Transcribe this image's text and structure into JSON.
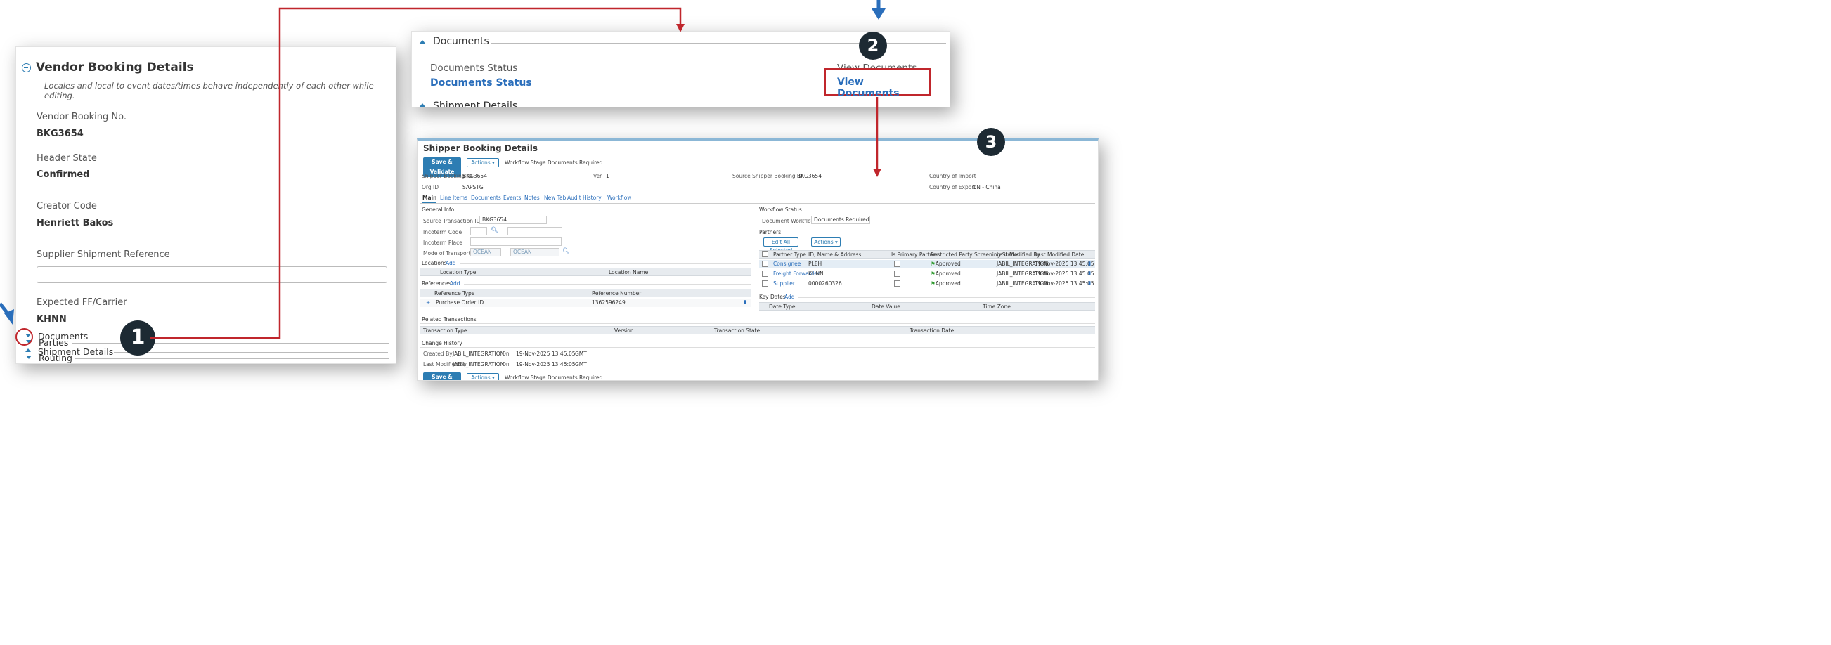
{
  "vendor": {
    "title": "Vendor Booking Details",
    "note": "Locales and local to event dates/times behave independently of each other while editing.",
    "booking_no_label": "Vendor Booking No.",
    "booking_no": "BKG3654",
    "header_state_label": "Header State",
    "header_state": "Confirmed",
    "creator_label": "Creator Code",
    "creator": "Henriett Bakos",
    "supplier_ref_label": "Supplier Shipment Reference",
    "supplier_ref_value": "",
    "carrier_label": "Expected FF/Carrier",
    "carrier": "KHNN",
    "sections": [
      "Parties",
      "Routing",
      "Documents",
      "Shipment Details"
    ]
  },
  "documents": {
    "title": "Documents",
    "status_label": "Documents Status",
    "status_link": "Documents Status",
    "view_label": "View Documents",
    "view_link": "View Documents",
    "next_section": "Shipment Details"
  },
  "steps": [
    "1",
    "2",
    "3"
  ],
  "shipper": {
    "title": "Shipper Booking Details",
    "save_btn": "Save & Validate",
    "actions_btn": "Actions",
    "workflow_stage": "Workflow Stage Documents Required",
    "booking_id_label": "Shipper Booking ID",
    "booking_id": "BKG3654",
    "ver_label": "Ver",
    "ver": "1",
    "source_id_label": "Source Shipper Booking ID",
    "source_id": "BKG3654",
    "org_label": "Org ID",
    "org": "SAPSTG",
    "country_import_label": "Country of Import",
    "country_import": "-",
    "country_export_label": "Country of Export",
    "country_export": "CN - China",
    "tabs": [
      "Main",
      "Line Items",
      "Documents",
      "Events",
      "Notes",
      "New Tab",
      "Audit History",
      "Workflow"
    ],
    "general_info": {
      "title": "General Info",
      "src_txn_label": "Source Transaction ID",
      "src_txn": "BKG3654",
      "incoterm_code_label": "Incoterm Code",
      "incoterm_place_label": "Incoterm Place",
      "mode_label": "Mode of Transport Code",
      "mode1": "OCEAN",
      "mode2": "OCEAN"
    },
    "locations": {
      "title": "Locations",
      "add": "Add",
      "col1": "Location Type",
      "col2": "Location Name"
    },
    "references": {
      "title": "References",
      "add": "Add",
      "col1": "Reference Type",
      "col2": "Reference Number",
      "row_type": "Purchase Order ID",
      "row_num": "1362596249"
    },
    "workflow": {
      "title": "Workflow Status",
      "label": "Document Workflow Stage",
      "value": "Documents Required"
    },
    "partners": {
      "title": "Partners",
      "edit_all": "Edit All Selected",
      "actions": "Actions",
      "headers": [
        "Partner Type",
        "ID, Name & Address",
        "Is Primary Partner",
        "Restricted Party Screening Status",
        "Last Modified By",
        "Last Modified Date"
      ],
      "rows": [
        {
          "type": "Consignee",
          "id": "PLEH",
          "status": "Approved",
          "by": "JABIL_INTEGRATION",
          "date": "19-Nov-2025 13:45:05"
        },
        {
          "type": "Freight Forwarder",
          "id": "KHNN",
          "status": "Approved",
          "by": "JABIL_INTEGRATION",
          "date": "19-Nov-2025 13:45:05"
        },
        {
          "type": "Supplier",
          "id": "0000260326",
          "status": "Approved",
          "by": "JABIL_INTEGRATION",
          "date": "19-Nov-2025 13:45:05"
        }
      ]
    },
    "key_dates": {
      "title": "Key Dates",
      "add": "Add",
      "col1": "Date Type",
      "col2": "Date Value",
      "col3": "Time Zone"
    },
    "related": {
      "title": "Related Transactions",
      "col1": "Transaction Type",
      "col2": "Version",
      "col3": "Transaction State",
      "col4": "Transaction Date"
    },
    "change_history": {
      "title": "Change History",
      "created_label": "Created By",
      "created_by": "JABIL_INTEGRATION",
      "on1": "On",
      "created_on": "19-Nov-2025 13:45:05",
      "tz1": "GMT",
      "modified_label": "Last Modified By",
      "modified_by": "JABIL_INTEGRATION",
      "on2": "On",
      "modified_on": "19-Nov-2025 13:45:05",
      "tz2": "GMT"
    }
  },
  "colors": {
    "accent": "#2d7db3",
    "callout_red": "#c0262c",
    "arrow_blue": "#2a6ebb",
    "link": "#2a6ebb"
  }
}
